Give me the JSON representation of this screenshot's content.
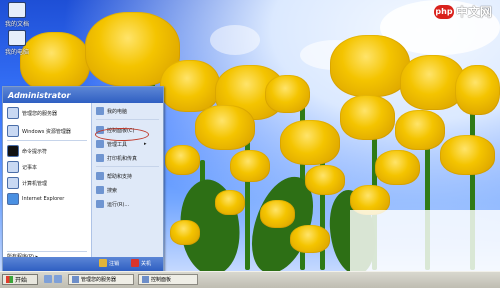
{
  "watermark": {
    "badge": "php",
    "text": "中文网"
  },
  "desktop_icons": [
    {
      "label": "我的文档"
    },
    {
      "label": "我的电脑"
    }
  ],
  "start_menu": {
    "user": "Administrator",
    "left_items": [
      {
        "label": "管理您的服务器"
      },
      {
        "label": "Windows 资源管理器"
      },
      {
        "label": "命令提示符"
      },
      {
        "label": "记事本"
      },
      {
        "label": "计算机管理"
      },
      {
        "label": "Internet Explorer"
      }
    ],
    "all_programs": "所有程序(P) ▸",
    "right_items": [
      {
        "label": "我的电脑"
      },
      {
        "label": "控制面板(C)"
      },
      {
        "label": "管理工具"
      },
      {
        "label": "打印机和传真"
      },
      {
        "label": "帮助和支持"
      },
      {
        "label": "搜索"
      },
      {
        "label": "运行(R)..."
      }
    ],
    "logoff": "注销",
    "shutdown": "关机"
  },
  "taskbar": {
    "start_label": "开始",
    "tasks": [
      {
        "label": "管理您的服务器"
      },
      {
        "label": "控制面板"
      }
    ]
  }
}
